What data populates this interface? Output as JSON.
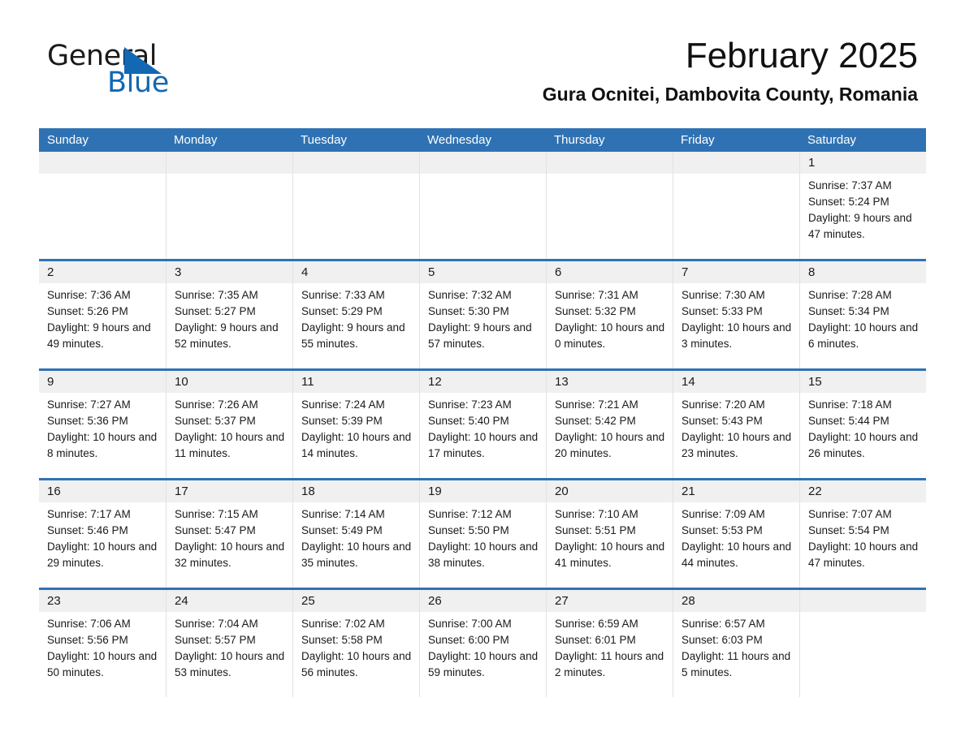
{
  "logo": {
    "word_top": "General",
    "word_bottom": "Blue",
    "triangle_icon": "blue-triangle-icon",
    "accent_color": "#1268b3"
  },
  "header": {
    "title": "February 2025",
    "subtitle": "Gura Ocnitei, Dambovita County, Romania"
  },
  "theme": {
    "header_blue": "#2f72b4",
    "daynum_gray": "#f0f0f0",
    "text": "#1a1a1a"
  },
  "calendar": {
    "weekday_headers": [
      "Sunday",
      "Monday",
      "Tuesday",
      "Wednesday",
      "Thursday",
      "Friday",
      "Saturday"
    ],
    "weeks": [
      [
        {
          "day": "",
          "empty": true
        },
        {
          "day": "",
          "empty": true
        },
        {
          "day": "",
          "empty": true
        },
        {
          "day": "",
          "empty": true
        },
        {
          "day": "",
          "empty": true
        },
        {
          "day": "",
          "empty": true
        },
        {
          "day": "1",
          "sunrise": "Sunrise: 7:37 AM",
          "sunset": "Sunset: 5:24 PM",
          "daylight": "Daylight: 9 hours and 47 minutes."
        }
      ],
      [
        {
          "day": "2",
          "sunrise": "Sunrise: 7:36 AM",
          "sunset": "Sunset: 5:26 PM",
          "daylight": "Daylight: 9 hours and 49 minutes."
        },
        {
          "day": "3",
          "sunrise": "Sunrise: 7:35 AM",
          "sunset": "Sunset: 5:27 PM",
          "daylight": "Daylight: 9 hours and 52 minutes."
        },
        {
          "day": "4",
          "sunrise": "Sunrise: 7:33 AM",
          "sunset": "Sunset: 5:29 PM",
          "daylight": "Daylight: 9 hours and 55 minutes."
        },
        {
          "day": "5",
          "sunrise": "Sunrise: 7:32 AM",
          "sunset": "Sunset: 5:30 PM",
          "daylight": "Daylight: 9 hours and 57 minutes."
        },
        {
          "day": "6",
          "sunrise": "Sunrise: 7:31 AM",
          "sunset": "Sunset: 5:32 PM",
          "daylight": "Daylight: 10 hours and 0 minutes."
        },
        {
          "day": "7",
          "sunrise": "Sunrise: 7:30 AM",
          "sunset": "Sunset: 5:33 PM",
          "daylight": "Daylight: 10 hours and 3 minutes."
        },
        {
          "day": "8",
          "sunrise": "Sunrise: 7:28 AM",
          "sunset": "Sunset: 5:34 PM",
          "daylight": "Daylight: 10 hours and 6 minutes."
        }
      ],
      [
        {
          "day": "9",
          "sunrise": "Sunrise: 7:27 AM",
          "sunset": "Sunset: 5:36 PM",
          "daylight": "Daylight: 10 hours and 8 minutes."
        },
        {
          "day": "10",
          "sunrise": "Sunrise: 7:26 AM",
          "sunset": "Sunset: 5:37 PM",
          "daylight": "Daylight: 10 hours and 11 minutes."
        },
        {
          "day": "11",
          "sunrise": "Sunrise: 7:24 AM",
          "sunset": "Sunset: 5:39 PM",
          "daylight": "Daylight: 10 hours and 14 minutes."
        },
        {
          "day": "12",
          "sunrise": "Sunrise: 7:23 AM",
          "sunset": "Sunset: 5:40 PM",
          "daylight": "Daylight: 10 hours and 17 minutes."
        },
        {
          "day": "13",
          "sunrise": "Sunrise: 7:21 AM",
          "sunset": "Sunset: 5:42 PM",
          "daylight": "Daylight: 10 hours and 20 minutes."
        },
        {
          "day": "14",
          "sunrise": "Sunrise: 7:20 AM",
          "sunset": "Sunset: 5:43 PM",
          "daylight": "Daylight: 10 hours and 23 minutes."
        },
        {
          "day": "15",
          "sunrise": "Sunrise: 7:18 AM",
          "sunset": "Sunset: 5:44 PM",
          "daylight": "Daylight: 10 hours and 26 minutes."
        }
      ],
      [
        {
          "day": "16",
          "sunrise": "Sunrise: 7:17 AM",
          "sunset": "Sunset: 5:46 PM",
          "daylight": "Daylight: 10 hours and 29 minutes."
        },
        {
          "day": "17",
          "sunrise": "Sunrise: 7:15 AM",
          "sunset": "Sunset: 5:47 PM",
          "daylight": "Daylight: 10 hours and 32 minutes."
        },
        {
          "day": "18",
          "sunrise": "Sunrise: 7:14 AM",
          "sunset": "Sunset: 5:49 PM",
          "daylight": "Daylight: 10 hours and 35 minutes."
        },
        {
          "day": "19",
          "sunrise": "Sunrise: 7:12 AM",
          "sunset": "Sunset: 5:50 PM",
          "daylight": "Daylight: 10 hours and 38 minutes."
        },
        {
          "day": "20",
          "sunrise": "Sunrise: 7:10 AM",
          "sunset": "Sunset: 5:51 PM",
          "daylight": "Daylight: 10 hours and 41 minutes."
        },
        {
          "day": "21",
          "sunrise": "Sunrise: 7:09 AM",
          "sunset": "Sunset: 5:53 PM",
          "daylight": "Daylight: 10 hours and 44 minutes."
        },
        {
          "day": "22",
          "sunrise": "Sunrise: 7:07 AM",
          "sunset": "Sunset: 5:54 PM",
          "daylight": "Daylight: 10 hours and 47 minutes."
        }
      ],
      [
        {
          "day": "23",
          "sunrise": "Sunrise: 7:06 AM",
          "sunset": "Sunset: 5:56 PM",
          "daylight": "Daylight: 10 hours and 50 minutes."
        },
        {
          "day": "24",
          "sunrise": "Sunrise: 7:04 AM",
          "sunset": "Sunset: 5:57 PM",
          "daylight": "Daylight: 10 hours and 53 minutes."
        },
        {
          "day": "25",
          "sunrise": "Sunrise: 7:02 AM",
          "sunset": "Sunset: 5:58 PM",
          "daylight": "Daylight: 10 hours and 56 minutes."
        },
        {
          "day": "26",
          "sunrise": "Sunrise: 7:00 AM",
          "sunset": "Sunset: 6:00 PM",
          "daylight": "Daylight: 10 hours and 59 minutes."
        },
        {
          "day": "27",
          "sunrise": "Sunrise: 6:59 AM",
          "sunset": "Sunset: 6:01 PM",
          "daylight": "Daylight: 11 hours and 2 minutes."
        },
        {
          "day": "28",
          "sunrise": "Sunrise: 6:57 AM",
          "sunset": "Sunset: 6:03 PM",
          "daylight": "Daylight: 11 hours and 5 minutes."
        },
        {
          "day": "",
          "empty": true
        }
      ]
    ]
  }
}
